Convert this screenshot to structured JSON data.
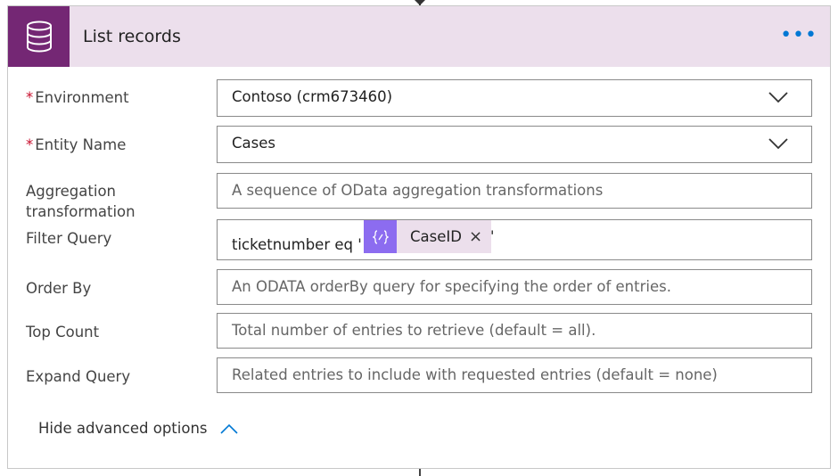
{
  "header": {
    "title": "List records",
    "more_label": "•••",
    "icon": "database-icon",
    "accent_color": "#742774",
    "header_bg": "#ecdfec"
  },
  "fields": {
    "environment": {
      "label": "Environment",
      "required_marker": "*",
      "value": "Contoso (crm673460)"
    },
    "entity": {
      "label": "Entity Name",
      "required_marker": "*",
      "value": "Cases"
    },
    "aggregation": {
      "label_line1": "Aggregation",
      "label_line2": "transformation",
      "placeholder": "A sequence of OData aggregation transformations"
    },
    "filter": {
      "label": "Filter Query",
      "prefix": "ticketnumber eq '",
      "token_label": "CaseID",
      "token_close": "×",
      "suffix": "'",
      "token_icon": "expression-icon",
      "token_color": "#8c6cf0"
    },
    "order_by": {
      "label": "Order By",
      "placeholder": "An ODATA orderBy query for specifying the order of entries."
    },
    "top_count": {
      "label": "Top Count",
      "placeholder": "Total number of entries to retrieve (default = all)."
    },
    "expand": {
      "label": "Expand Query",
      "placeholder": "Related entries to include with requested entries (default = none)"
    }
  },
  "footer": {
    "advanced_label": "Hide advanced options",
    "icon": "chevron-up-icon"
  }
}
